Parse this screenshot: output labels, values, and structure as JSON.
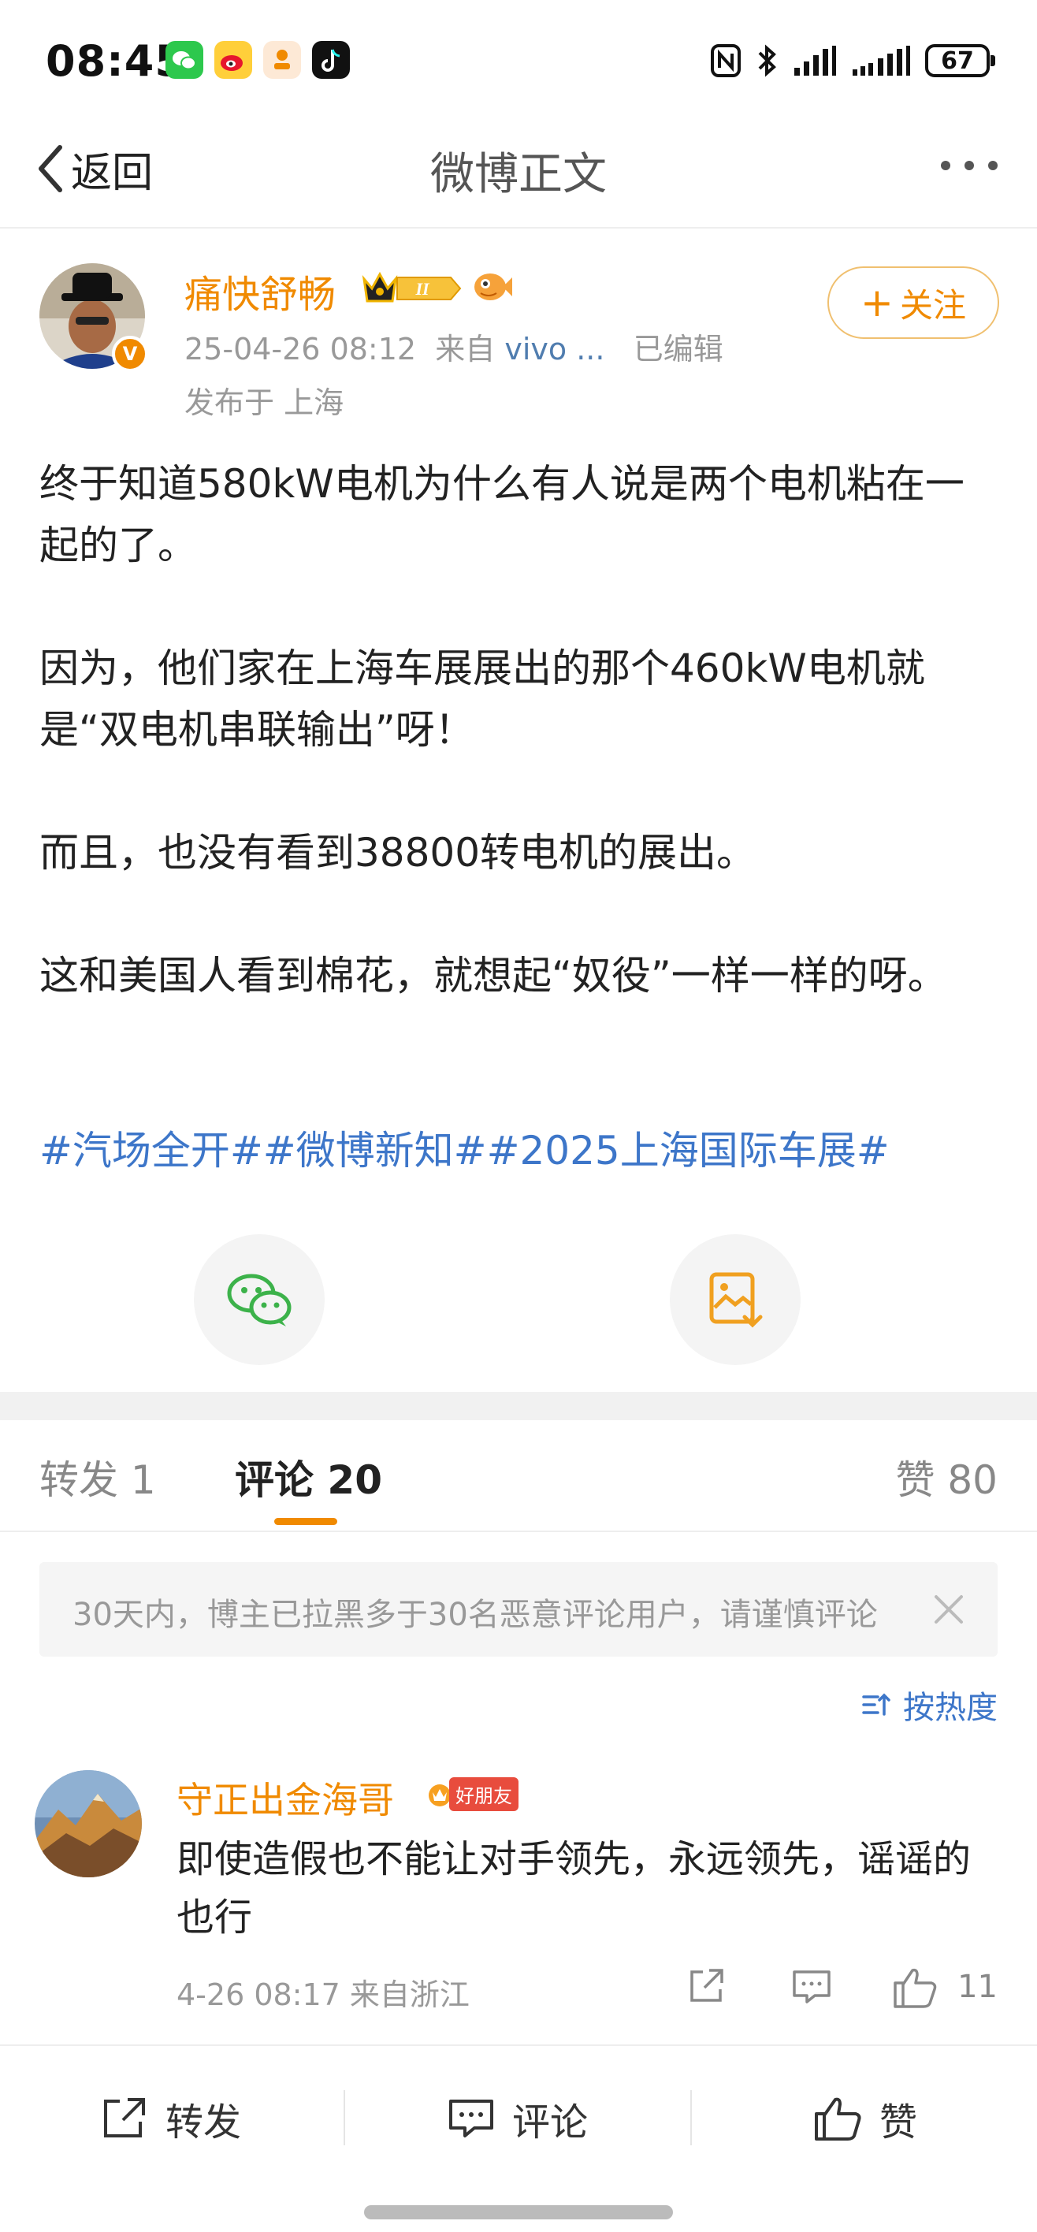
{
  "status_bar": {
    "time": "08:45",
    "apps": [
      "wechat-icon",
      "weibo-icon",
      "app-icon",
      "tiktok-icon"
    ],
    "battery": "67"
  },
  "nav": {
    "back_label": "返回",
    "title": "微博正文"
  },
  "post": {
    "author": "痛快舒畅",
    "verified_badge": "V",
    "level_badge": "II",
    "timestamp": "25-04-26 08:12",
    "source_prefix": "来自",
    "source": "vivo ...",
    "edited": "已编辑",
    "location": "发布于 上海",
    "follow_label": "关注",
    "paragraphs": [
      "终于知道580kW电机为什么有人说是两个电机粘在一起的了。",
      "因为，他们家在上海车展展出的那个460kW电机就是“双电机串联输出”呀！",
      "而且，也没有看到38800转电机的展出。",
      "这和美国人看到棉花，就想起“奴役”一样一样的呀。"
    ],
    "hashtags": "#汽场全开##微博新知##2025上海国际车展#"
  },
  "tabs": {
    "repost": "转发 1",
    "comment": "评论 20",
    "like": "赞 80"
  },
  "notice": "30天内，博主已拉黑多于30名恶意评论用户，请谨慎评论",
  "sort_label": "按热度",
  "comment": {
    "author": "守正出金海哥",
    "badge": "好朋友",
    "text": "即使造假也不能让对手领先，永远领先，谣谣的也行",
    "meta": "4-26 08:17 来自浙江",
    "likes": "11"
  },
  "bottom_bar": {
    "repost": "转发",
    "comment": "评论",
    "like": "赞"
  },
  "colors": {
    "accent": "#f08a00",
    "link": "#3d76c9",
    "muted": "#999999"
  }
}
